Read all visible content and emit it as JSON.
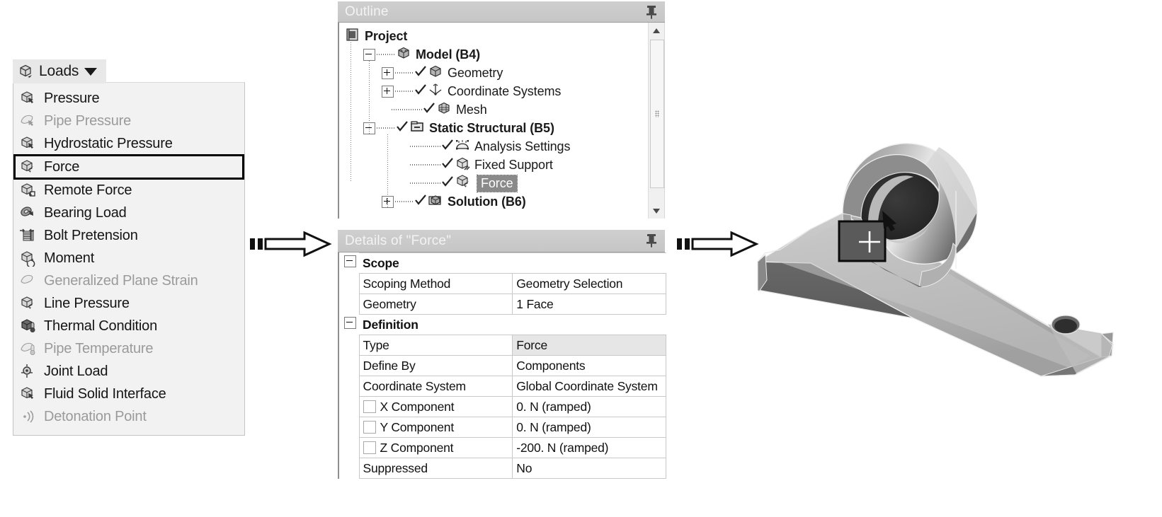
{
  "loads": {
    "button_label": "Loads",
    "button_icon": "loads-cube-icon",
    "caret_icon": "chevron-down-icon",
    "items": [
      {
        "label": "Pressure",
        "icon": "pressure-icon",
        "disabled": false,
        "selected": false
      },
      {
        "label": "Pipe Pressure",
        "icon": "pipe-pressure-icon",
        "disabled": true,
        "selected": false
      },
      {
        "label": "Hydrostatic Pressure",
        "icon": "hydrostatic-pressure-icon",
        "disabled": false,
        "selected": false
      },
      {
        "label": "Force",
        "icon": "force-icon",
        "disabled": false,
        "selected": true
      },
      {
        "label": "Remote Force",
        "icon": "remote-force-icon",
        "disabled": false,
        "selected": false
      },
      {
        "label": "Bearing Load",
        "icon": "bearing-load-icon",
        "disabled": false,
        "selected": false
      },
      {
        "label": "Bolt Pretension",
        "icon": "bolt-pretension-icon",
        "disabled": false,
        "selected": false
      },
      {
        "label": "Moment",
        "icon": "moment-icon",
        "disabled": false,
        "selected": false
      },
      {
        "label": "Generalized Plane Strain",
        "icon": "generalized-plane-strain-icon",
        "disabled": true,
        "selected": false
      },
      {
        "label": "Line Pressure",
        "icon": "line-pressure-icon",
        "disabled": false,
        "selected": false
      },
      {
        "label": "Thermal Condition",
        "icon": "thermal-condition-icon",
        "disabled": false,
        "selected": false
      },
      {
        "label": "Pipe Temperature",
        "icon": "pipe-temperature-icon",
        "disabled": true,
        "selected": false
      },
      {
        "label": "Joint Load",
        "icon": "joint-load-icon",
        "disabled": false,
        "selected": false
      },
      {
        "label": "Fluid Solid Interface",
        "icon": "fluid-solid-interface-icon",
        "disabled": false,
        "selected": false
      },
      {
        "label": "Detonation Point",
        "icon": "detonation-point-icon",
        "disabled": true,
        "selected": false
      }
    ]
  },
  "outline": {
    "title": "Outline",
    "pin_icon": "pin-icon",
    "scrollbar": {
      "up_icon": "scroll-up-arrow-icon",
      "down_icon": "scroll-down-arrow-icon",
      "thumb": "scrollbar-thumb"
    },
    "tree": [
      {
        "label": "Project",
        "depth": 0,
        "expander": "none",
        "bold": true,
        "check": false,
        "icon": "project-icon",
        "highlighted": false
      },
      {
        "label": "Model (B4)",
        "depth": 1,
        "expander": "minus",
        "bold": true,
        "check": false,
        "icon": "model-icon",
        "highlighted": false
      },
      {
        "label": "Geometry",
        "depth": 2,
        "expander": "plus",
        "bold": false,
        "check": true,
        "icon": "geometry-icon",
        "highlighted": false
      },
      {
        "label": "Coordinate Systems",
        "depth": 2,
        "expander": "plus",
        "bold": false,
        "check": true,
        "icon": "coordinate-systems-icon",
        "highlighted": false
      },
      {
        "label": "Mesh",
        "depth": 2,
        "expander": "none",
        "bold": false,
        "check": true,
        "icon": "mesh-icon",
        "highlighted": false
      },
      {
        "label": "Static Structural (B5)",
        "depth": 1,
        "expander": "minus",
        "bold": true,
        "check": true,
        "icon": "environment-folder-icon",
        "highlighted": false
      },
      {
        "label": "Analysis Settings",
        "depth": 3,
        "expander": "none",
        "bold": false,
        "check": true,
        "icon": "analysis-settings-icon",
        "highlighted": false
      },
      {
        "label": "Fixed Support",
        "depth": 3,
        "expander": "none",
        "bold": false,
        "check": true,
        "icon": "fixed-support-icon",
        "highlighted": false
      },
      {
        "label": "Force",
        "depth": 3,
        "expander": "none",
        "bold": false,
        "check": true,
        "icon": "force-icon",
        "highlighted": true
      },
      {
        "label": "Solution (B6)",
        "depth": 2,
        "expander": "plus",
        "bold": true,
        "check": true,
        "icon": "solution-icon",
        "highlighted": false
      }
    ]
  },
  "details": {
    "title": "Details of \"Force\"",
    "pin_icon": "pin-icon",
    "rows": [
      {
        "kind": "group",
        "key": "Scope"
      },
      {
        "kind": "prop",
        "key": "Scoping Method",
        "value": "Geometry Selection",
        "checkbox": false,
        "shaded": false
      },
      {
        "kind": "prop",
        "key": "Geometry",
        "value": "1 Face",
        "checkbox": false,
        "shaded": false
      },
      {
        "kind": "group",
        "key": "Definition"
      },
      {
        "kind": "prop",
        "key": "Type",
        "value": "Force",
        "checkbox": false,
        "shaded": true
      },
      {
        "kind": "prop",
        "key": "Define By",
        "value": "Components",
        "checkbox": false,
        "shaded": false
      },
      {
        "kind": "prop",
        "key": "Coordinate System",
        "value": "Global Coordinate System",
        "checkbox": false,
        "shaded": false
      },
      {
        "kind": "prop",
        "key": "X Component",
        "value": "0. N  (ramped)",
        "checkbox": true,
        "shaded": false
      },
      {
        "kind": "prop",
        "key": "Y Component",
        "value": "0. N  (ramped)",
        "checkbox": true,
        "shaded": false
      },
      {
        "kind": "prop",
        "key": "Z Component",
        "value": "-200. N  (ramped)",
        "checkbox": true,
        "shaded": false
      },
      {
        "kind": "prop",
        "key": "Suppressed",
        "value": "No",
        "checkbox": false,
        "shaded": false
      }
    ]
  },
  "arrows": [
    {
      "name": "arrow-loads-to-outline",
      "icon": "block-arrow-right-icon"
    },
    {
      "name": "arrow-details-to-model",
      "icon": "block-arrow-right-icon"
    }
  ],
  "model": {
    "name": "bracket-3d-model",
    "selected_face_marker": "selected-face-highlight",
    "crosshair": "selection-crosshair-icon"
  }
}
